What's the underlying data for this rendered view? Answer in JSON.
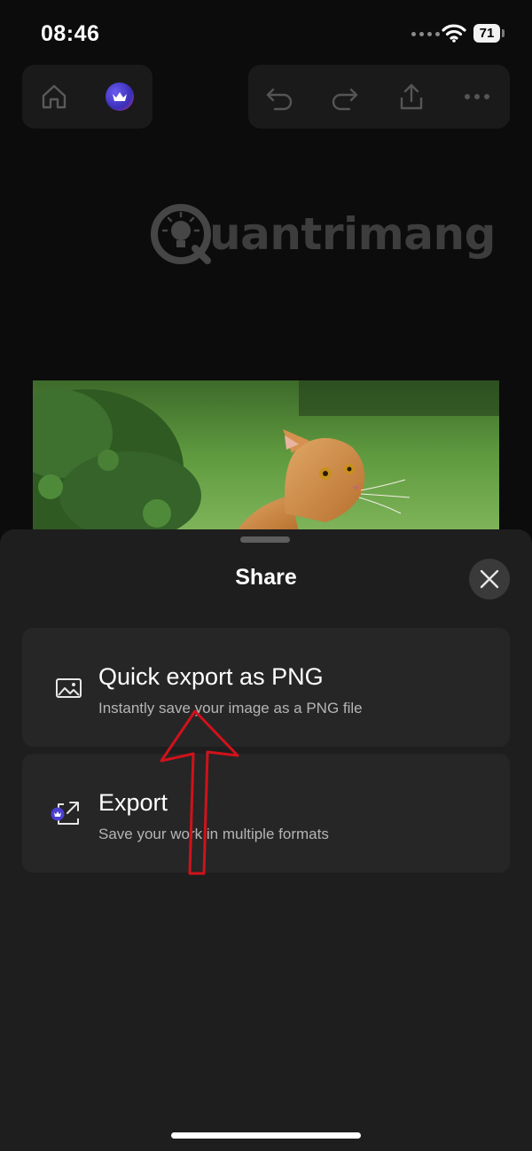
{
  "status_bar": {
    "time": "08:46",
    "battery": "71",
    "icons": [
      "signal-dots-icon",
      "wifi-icon",
      "battery-icon"
    ]
  },
  "toolbar": {
    "left": [
      "home-icon",
      "premium-crown-icon"
    ],
    "right": [
      "undo-icon",
      "redo-icon",
      "share-icon",
      "more-icon"
    ]
  },
  "watermark": {
    "text": "uantrimang"
  },
  "share_sheet": {
    "title": "Share",
    "close_icon": "close-icon",
    "options": [
      {
        "title": "Quick export as PNG",
        "subtitle": "Instantly save your image as a PNG file",
        "icon": "image-icon"
      },
      {
        "title": "Export",
        "subtitle": "Save your work in multiple formats",
        "icon": "export-icon"
      }
    ]
  },
  "colors": {
    "background": "#0c0c0c",
    "sheet": "#1e1e1e",
    "option_card": "#262626",
    "annotation_arrow": "#d0121b",
    "premium_badge": "#4a3fd0"
  }
}
